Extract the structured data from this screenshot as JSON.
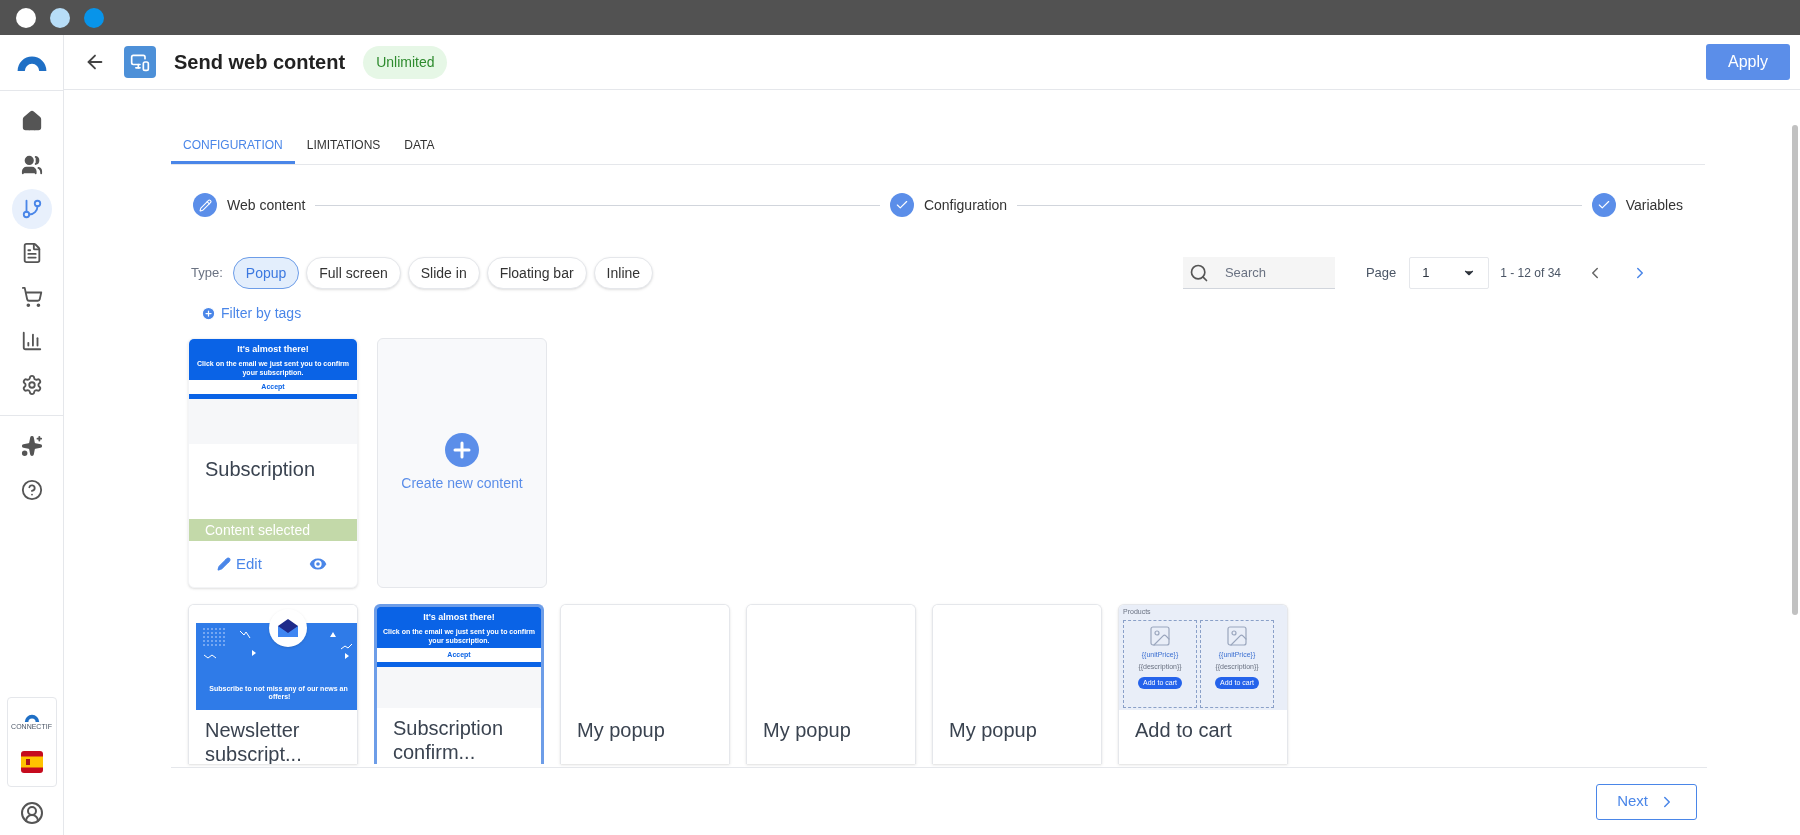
{
  "sidebar": {
    "items": [
      {
        "kind": "home",
        "selected": false
      },
      {
        "kind": "people",
        "selected": false
      },
      {
        "kind": "flow",
        "selected": true
      },
      {
        "kind": "document",
        "selected": false
      },
      {
        "kind": "cart",
        "selected": false
      },
      {
        "kind": "chart",
        "selected": false
      },
      {
        "kind": "settings",
        "selected": false
      },
      {
        "kind": "sparkles",
        "selected": false
      },
      {
        "kind": "help",
        "selected": false
      }
    ],
    "brand": "CONNECTIF"
  },
  "header": {
    "title": "Send web content",
    "badge": "Unlimited",
    "apply": "Apply"
  },
  "tabs": [
    {
      "label": "CONFIGURATION",
      "selected": true
    },
    {
      "label": "LIMITATIONS",
      "selected": false
    },
    {
      "label": "DATA",
      "selected": false
    }
  ],
  "steps": [
    {
      "label": "Web content",
      "kind": "edit"
    },
    {
      "label": "Configuration",
      "kind": "done"
    },
    {
      "label": "Variables",
      "kind": "done"
    }
  ],
  "filters": {
    "type_label": "Type:",
    "types": [
      {
        "label": "Popup",
        "selected": true
      },
      {
        "label": "Full screen",
        "selected": false
      },
      {
        "label": "Slide in",
        "selected": false
      },
      {
        "label": "Floating bar",
        "selected": false
      },
      {
        "label": "Inline",
        "selected": false
      }
    ],
    "filter_by_tags": "Filter by tags",
    "search": {
      "placeholder": "Search"
    },
    "page_label": "Page",
    "page": "1",
    "range": "1 - 12 of 34"
  },
  "current": {
    "preview": {
      "kind": "subscription",
      "heading": "It's almost there!",
      "text": "Click on the email we just sent you to confirm your subscription.",
      "button": "Accept"
    },
    "title": "Subscription",
    "status": "Content selected",
    "edit": "Edit"
  },
  "create": {
    "label": "Create new content"
  },
  "gallery": [
    {
      "title": "Newsletter subscript...",
      "selected": false,
      "preview": {
        "kind": "newsletter",
        "text": "Subscribe to not miss any of our news an offers!"
      }
    },
    {
      "title": "Subscription confirm...",
      "selected": true,
      "preview": {
        "kind": "subscription",
        "heading": "It's almost there!",
        "text": "Click on the email we just sent you to confirm your subscription.",
        "button": "Accept"
      }
    },
    {
      "title": "My popup",
      "selected": false
    },
    {
      "title": "My popup",
      "selected": false
    },
    {
      "title": "My popup",
      "selected": false
    },
    {
      "title": "Add to cart",
      "selected": false,
      "preview": {
        "kind": "products",
        "heading": "Products",
        "items": [
          {
            "price": "{{unitPrice}}",
            "description": "{{description}}",
            "button": "Add to cart"
          },
          {
            "price": "{{unitPrice}}",
            "description": "{{description}}",
            "button": "Add to cart"
          }
        ]
      }
    }
  ],
  "footer": {
    "next": "Next"
  }
}
